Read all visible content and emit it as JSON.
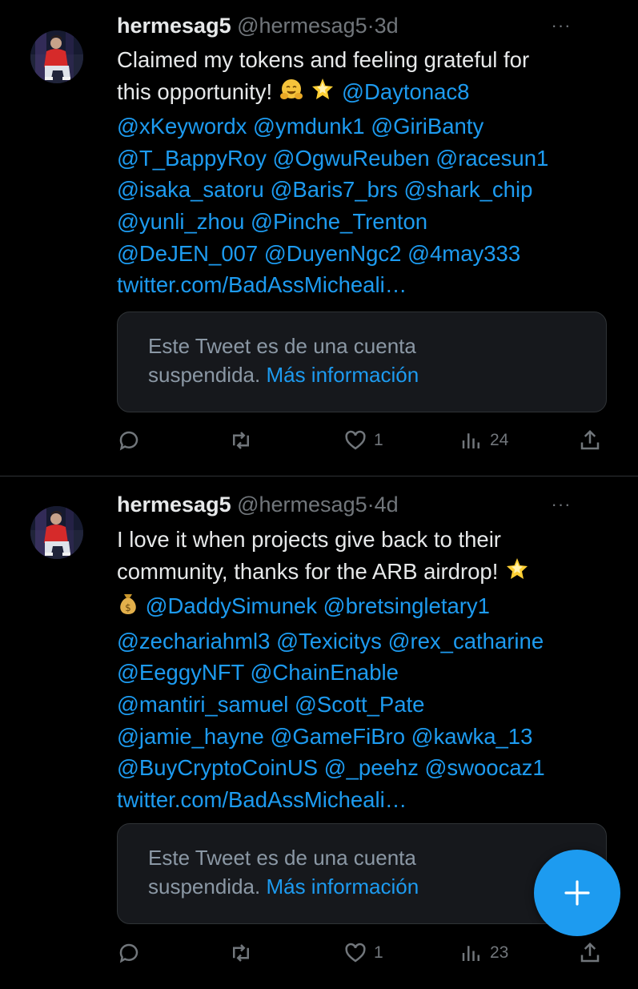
{
  "colors": {
    "background": "#000000",
    "text": "#e7e9ea",
    "muted": "#71767b",
    "link": "#1d9bf0",
    "card": "#16181c"
  },
  "tweets": [
    {
      "name": "hermesag5",
      "handle": "@hermesag5",
      "separator": "·",
      "time": "3d",
      "more": "···",
      "lines": [
        {
          "text": "Claimed my tokens and feeling grateful for",
          "mentions": ""
        },
        {
          "text": "this opportunity! ",
          "emojis": [
            "hugging-face",
            "glowing-star"
          ],
          "mentions": " @Daytonac8"
        },
        {
          "text": "",
          "mentions": "@xKeywordx @ymdunk1 @GiriBanty"
        },
        {
          "text": "",
          "mentions": "@T_BappyRoy @OgwuReuben @racesun1"
        },
        {
          "text": "",
          "mentions": "@isaka_satoru @Baris7_brs @shark_chip"
        },
        {
          "text": "",
          "mentions": "@yunli_zhou @Pinche_Trenton"
        },
        {
          "text": "",
          "mentions": "@DeJEN_007 @DuyenNgc2 @4may333"
        },
        {
          "text": "",
          "mentions": "twitter.com/BadAssMicheali…"
        }
      ],
      "quote": {
        "line1": "Este Tweet es de una cuenta",
        "line2": "suspendida. ",
        "link": "Más información"
      },
      "actions": {
        "reply": "",
        "retweet": "",
        "likes": "1",
        "views": "24",
        "share": ""
      }
    },
    {
      "name": "hermesag5",
      "handle": "@hermesag5",
      "separator": "·",
      "time": "4d",
      "more": "···",
      "lines": [
        {
          "text": "I love it when projects give back to their",
          "mentions": ""
        },
        {
          "text": "community, thanks for the ARB airdrop! ",
          "emojis": [
            "glowing-star"
          ],
          "mentions": ""
        },
        {
          "text": "",
          "emojis": [
            "money-bag"
          ],
          "mentions": " @DaddySimunek @bretsingletary1"
        },
        {
          "text": "",
          "mentions": "@zechariahml3 @Texicitys @rex_catharine"
        },
        {
          "text": "",
          "mentions": "@EeggyNFT @ChainEnable"
        },
        {
          "text": "",
          "mentions": "@mantiri_samuel @Scott_Pate"
        },
        {
          "text": "",
          "mentions": "@jamie_hayne @GameFiBro @kawka_13"
        },
        {
          "text": "",
          "mentions": "@BuyCryptoCoinUS @_peehz @swoocaz1"
        },
        {
          "text": "",
          "mentions": "twitter.com/BadAssMicheali…"
        }
      ],
      "quote": {
        "line1": "Este Tweet es de una cuenta",
        "line2": "suspendida. ",
        "link": "Más información"
      },
      "actions": {
        "reply": "",
        "retweet": "",
        "likes": "1",
        "views": "23",
        "share": ""
      }
    }
  ],
  "fab": {
    "icon": "plus-icon"
  }
}
